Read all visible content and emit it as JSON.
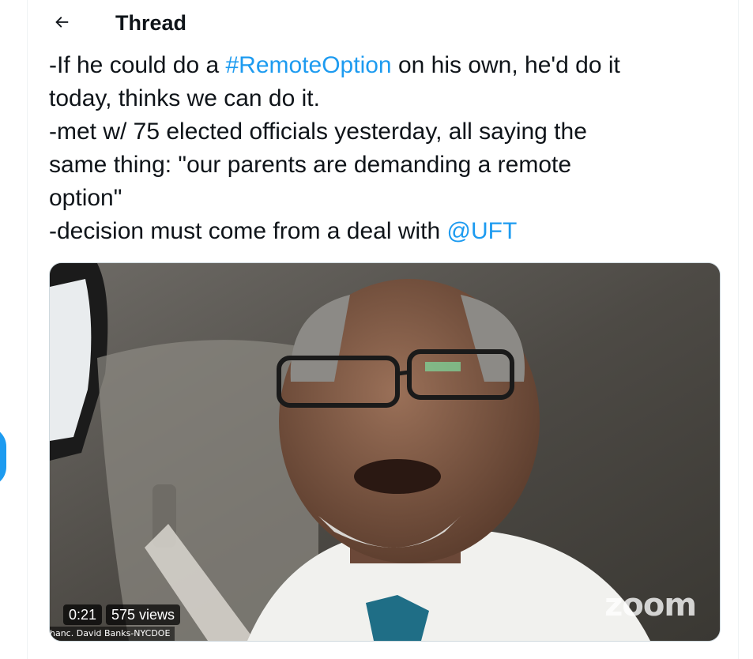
{
  "header": {
    "title": "Thread",
    "back_icon": "arrow-left-icon"
  },
  "tweet": {
    "lines": [
      {
        "before": "-If he could do a ",
        "hashtag": "#RemoteOption",
        "after": " on his own, he'd do it"
      },
      {
        "text": "today, thinks we can do it."
      },
      {
        "text": "-met w/ 75 elected officials yesterday, all saying the"
      },
      {
        "text": "same thing: \"our parents are demanding a remote"
      },
      {
        "text": "option\""
      },
      {
        "before": "-decision must come from a deal with ",
        "mention": "@UFT"
      }
    ],
    "link_color": "#1d9bf0"
  },
  "video": {
    "duration": "0:21",
    "views": "575 views",
    "watermark": "zoom",
    "name_tag": "hanc. David Banks-NYCDOE"
  },
  "colors": {
    "accent": "#1d9bf0",
    "text": "#0f1419",
    "border": "#eff3f4"
  }
}
